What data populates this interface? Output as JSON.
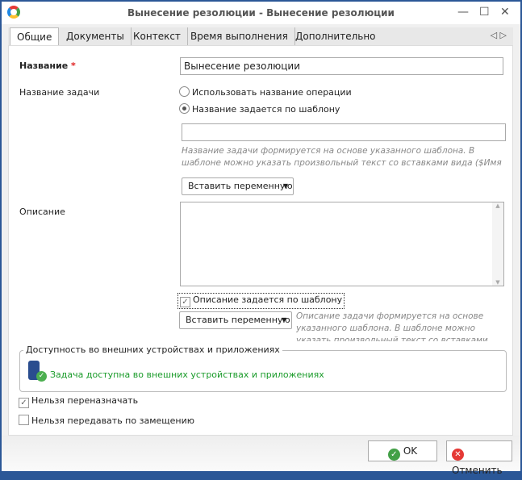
{
  "window": {
    "title": "Вынесение резолюции - Вынесение резолюции",
    "minimize": "—",
    "maximize": "☐",
    "close": "✕"
  },
  "tabs": [
    "Общие",
    "Документы",
    "Контекст",
    "Время выполнения",
    "Дополнительно"
  ],
  "tab_arrows": "◁ ▷",
  "form": {
    "name_label": "Название",
    "required_mark": "*",
    "name_value": "Вынесение резолюции",
    "task_name_label": "Название задачи",
    "radio_use_operation": "Использовать название операции",
    "radio_template": "Название задается по шаблону",
    "task_template_value": "",
    "task_hint": "Название задачи формируется на основе указанного шаблона. В шаблоне можно указать произвольный текст со вставками вида ($Имя переменной)",
    "insert_variable": "Вставить переменную",
    "description_label": "Описание",
    "description_value": "",
    "desc_template_checkbox": "Описание задается по шаблону",
    "desc_hint": "Описание задачи формируется на основе указанного шаблона. В шаблоне можно указать произвольный текст со вставками вида ($Имя переменной)",
    "availability_group": "Доступность во внешних устройствах и приложениях",
    "availability_text": "Задача доступна во внешних устройствах и приложениях",
    "no_reassign": "Нельзя переназначать",
    "no_substitute": "Нельзя передавать по замещению"
  },
  "footer": {
    "ok": "OK",
    "cancel": "Отменить"
  },
  "colors": {
    "border": "#2b5797",
    "green": "#1a9b2a",
    "required": "#e02020"
  }
}
